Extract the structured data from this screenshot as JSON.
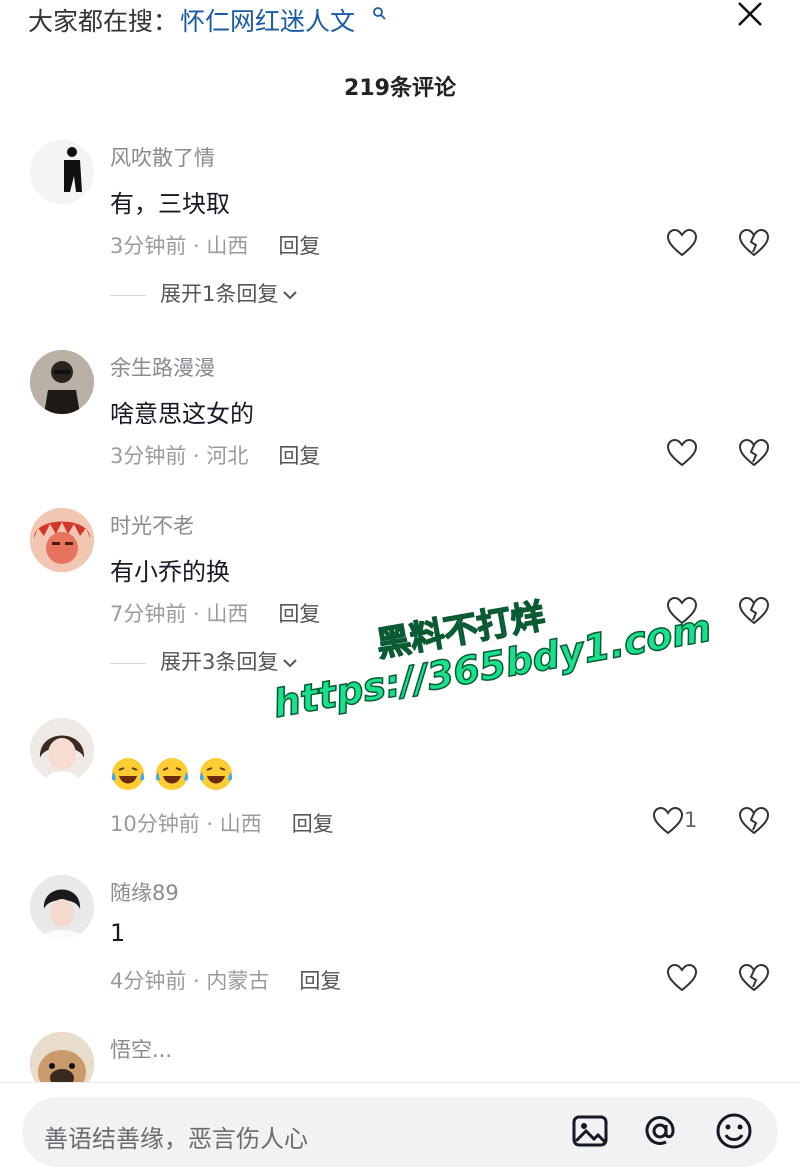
{
  "header": {
    "search_prefix": "大家都在搜：",
    "search_term": "怀仁网红迷人文",
    "comment_count": "219条评论"
  },
  "comments": [
    {
      "username": "风吹散了情",
      "content": "有，三块取",
      "meta": "3分钟前 · 山西",
      "reply_label": "回复",
      "expand_label": "展开1条回复"
    },
    {
      "username": "余生路漫漫",
      "content": "啥意思这女的",
      "meta": "3分钟前 · 河北",
      "reply_label": "回复"
    },
    {
      "username": "时光不老",
      "content": "有小乔的换",
      "meta": "7分钟前 · 山西",
      "reply_label": "回复",
      "expand_label": "展开3条回复"
    },
    {
      "username": "",
      "content_emoji": [
        "laughing-crying-emoji",
        "laughing-crying-emoji",
        "laughing-crying-emoji"
      ],
      "meta": "10分钟前 · 山西",
      "reply_label": "回复",
      "like_count": "1"
    },
    {
      "username": "随缘89",
      "content": "1",
      "meta": "4分钟前 · 内蒙古",
      "reply_label": "回复"
    },
    {
      "username": "悟空..."
    }
  ],
  "watermark": {
    "line1": "黑料不打烊",
    "line2": "https://365bdy1.com"
  },
  "composer": {
    "placeholder": "善语结善缘，恶言伤人心",
    "icons": [
      "image-icon",
      "at-mention-icon",
      "emoji-icon"
    ]
  },
  "colors": {
    "search_term": "#1a5aa6",
    "username": "#8a8b91",
    "watermark_fill": "#18e08c",
    "watermark_stroke": "#0a5a34",
    "input_bg": "#f2f2f4"
  }
}
